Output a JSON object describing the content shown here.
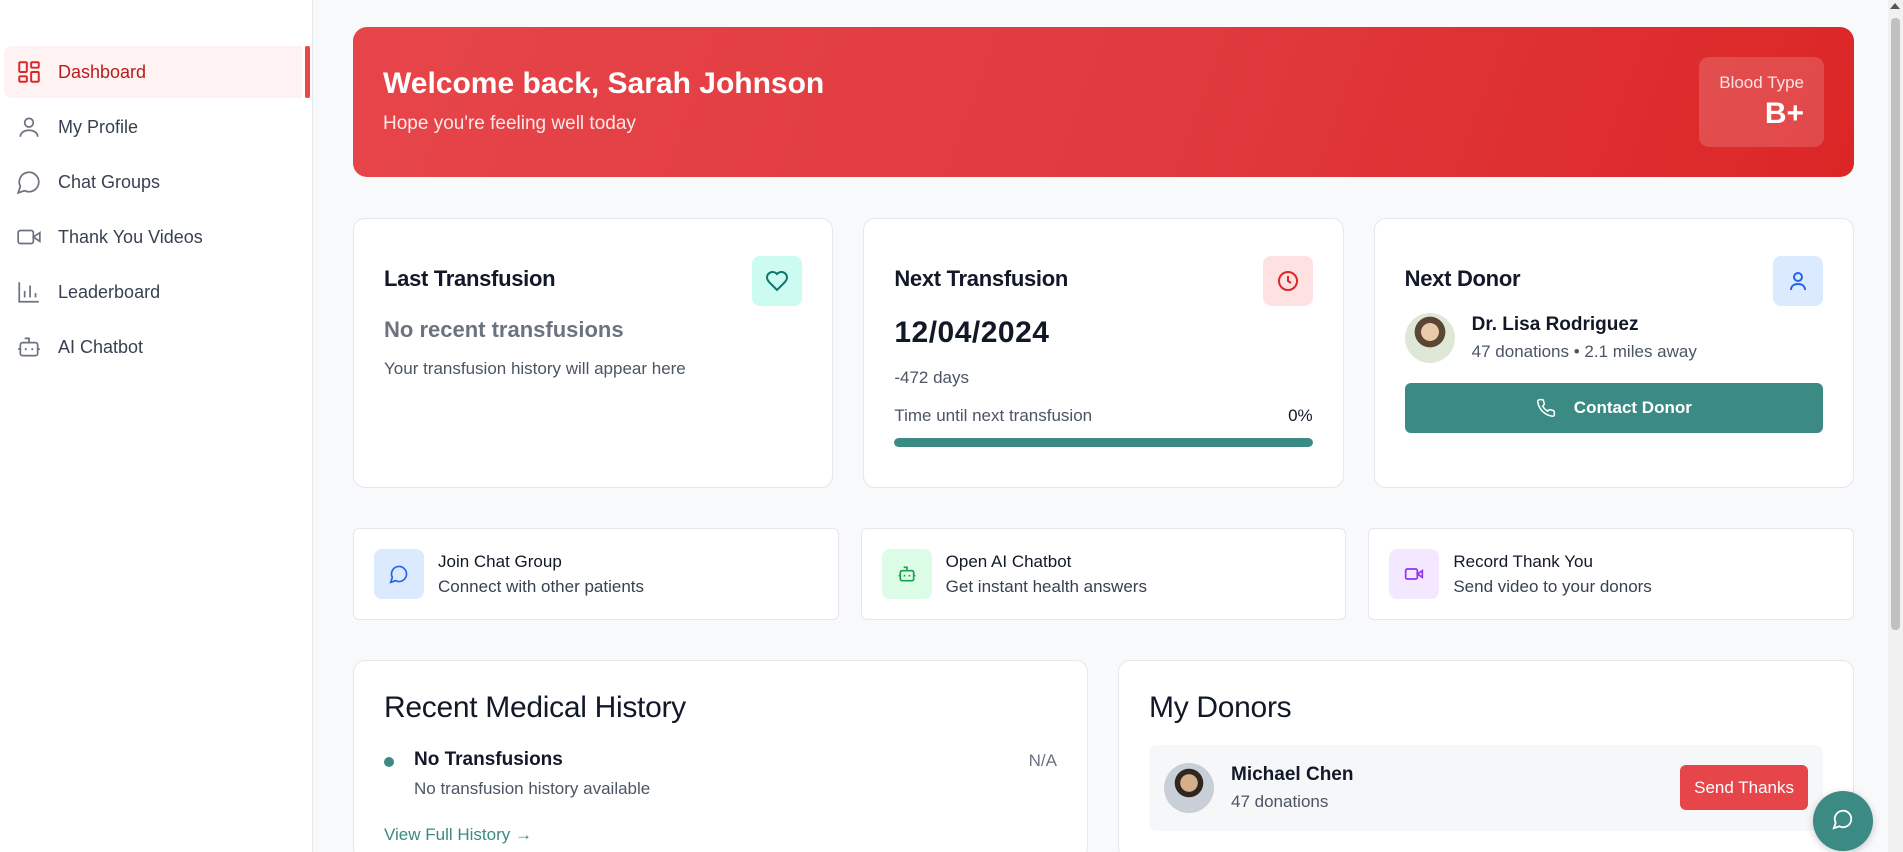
{
  "sidebar": {
    "items": [
      {
        "label": "Dashboard",
        "icon": "grid-icon",
        "active": true
      },
      {
        "label": "My Profile",
        "icon": "user-icon"
      },
      {
        "label": "Chat Groups",
        "icon": "chat-icon"
      },
      {
        "label": "Thank You Videos",
        "icon": "video-icon"
      },
      {
        "label": "Leaderboard",
        "icon": "bar-chart-icon"
      },
      {
        "label": "AI Chatbot",
        "icon": "bot-icon"
      }
    ]
  },
  "hero": {
    "title": "Welcome back, Sarah Johnson",
    "subtitle": "Hope you're feeling well today",
    "blood_type_label": "Blood Type",
    "blood_type_value": "B+"
  },
  "cards": {
    "last": {
      "title": "Last Transfusion",
      "empty_title": "No recent transfusions",
      "empty_note": "Your transfusion history will appear here",
      "icon": "heart-icon"
    },
    "next": {
      "title": "Next Transfusion",
      "date": "12/04/2024",
      "days": "-472 days",
      "progress_label": "Time until next transfusion",
      "progress_text": "0%",
      "progress_value": 0,
      "icon": "clock-icon"
    },
    "donor": {
      "title": "Next Donor",
      "name": "Dr. Lisa Rodriguez",
      "meta": "47 donations • 2.1 miles away",
      "button": "Contact Donor",
      "icon": "user-icon"
    }
  },
  "actions": [
    {
      "title": "Join Chat Group",
      "subtitle": "Connect with other patients",
      "icon": "chat-icon"
    },
    {
      "title": "Open AI Chatbot",
      "subtitle": "Get instant health answers",
      "icon": "bot-icon"
    },
    {
      "title": "Record Thank You",
      "subtitle": "Send video to your donors",
      "icon": "video-icon"
    }
  ],
  "history": {
    "title": "Recent Medical History",
    "item_name": "No Transfusions",
    "item_sub": "No transfusion history available",
    "item_date": "N/A",
    "link": "View Full History →"
  },
  "donors": {
    "title": "My Donors",
    "name": "Michael Chen",
    "meta": "47 donations",
    "button": "Send Thanks"
  },
  "colors": {
    "brand_red": "#e6454a",
    "teal": "#3b8a83"
  }
}
